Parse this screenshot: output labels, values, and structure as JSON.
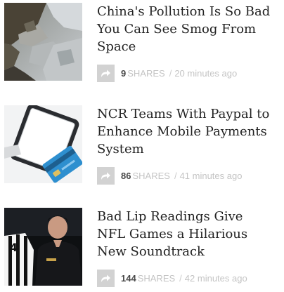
{
  "feed": {
    "items": [
      {
        "title_lines": [
          "China's Pollution Is So Bad",
          "You Can See Smog From",
          "Space"
        ],
        "share_count": "9",
        "shares_label": "SHARES",
        "separator": "/",
        "time": "20 minutes ago",
        "thumbnail_icon": "satellite-smog-image"
      },
      {
        "title_lines": [
          "NCR Teams With Paypal to",
          "Enhance Mobile Payments",
          "System"
        ],
        "share_count": "86",
        "shares_label": "SHARES",
        "separator": "/",
        "time": "41 minutes ago",
        "thumbnail_icon": "phone-card-image"
      },
      {
        "title_lines": [
          "Bad Lip Readings Give",
          "NFL Games a Hilarious",
          "New Soundtrack"
        ],
        "share_count": "144",
        "shares_label": "SHARES",
        "separator": "/",
        "time": "42 minutes ago",
        "thumbnail_icon": "nfl-referee-coach-image"
      }
    ],
    "share_icon": "share-arrow-icon",
    "colors": {
      "title": "#222222",
      "meta": "#c4c4c4",
      "share_button": "#d2d2d2",
      "share_count": "#4a4a4a"
    }
  }
}
